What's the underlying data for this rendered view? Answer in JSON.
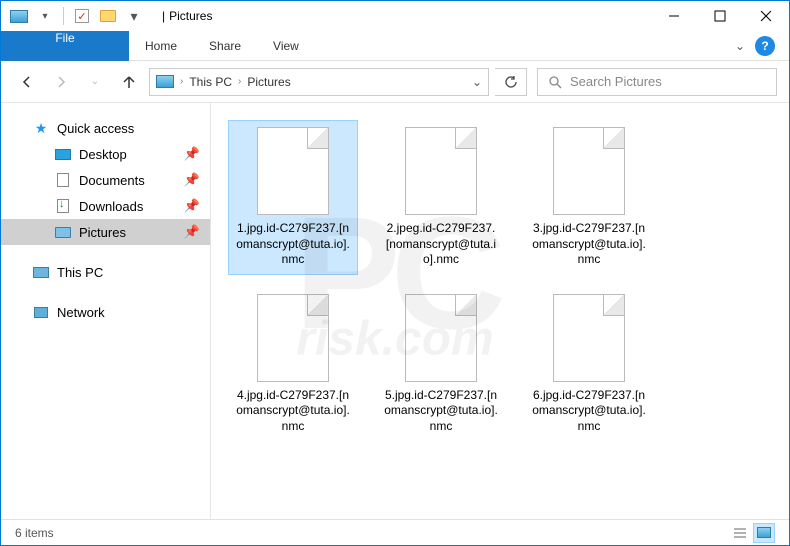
{
  "title_sep": "|",
  "window_title": "Pictures",
  "ribbon": {
    "file": "File",
    "home": "Home",
    "share": "Share",
    "view": "View"
  },
  "addr": {
    "root": "This PC",
    "folder": "Pictures"
  },
  "search": {
    "placeholder": "Search Pictures"
  },
  "sidebar": {
    "quick": "Quick access",
    "items": [
      {
        "label": "Desktop"
      },
      {
        "label": "Documents"
      },
      {
        "label": "Downloads"
      },
      {
        "label": "Pictures"
      }
    ],
    "thispc": "This PC",
    "network": "Network"
  },
  "files": [
    {
      "name": "1.jpg.id-C279F237.[nomanscrypt@tuta.io].nmc"
    },
    {
      "name": "2.jpeg.id-C279F237.[nomanscrypt@tuta.io].nmc"
    },
    {
      "name": "3.jpg.id-C279F237.[nomanscrypt@tuta.io].nmc"
    },
    {
      "name": "4.jpg.id-C279F237.[nomanscrypt@tuta.io].nmc"
    },
    {
      "name": "5.jpg.id-C279F237.[nomanscrypt@tuta.io].nmc"
    },
    {
      "name": "6.jpg.id-C279F237.[nomanscrypt@tuta.io].nmc"
    }
  ],
  "status": {
    "count": "6 items"
  },
  "watermark": {
    "big": "PC",
    "sub": "risk.com"
  }
}
